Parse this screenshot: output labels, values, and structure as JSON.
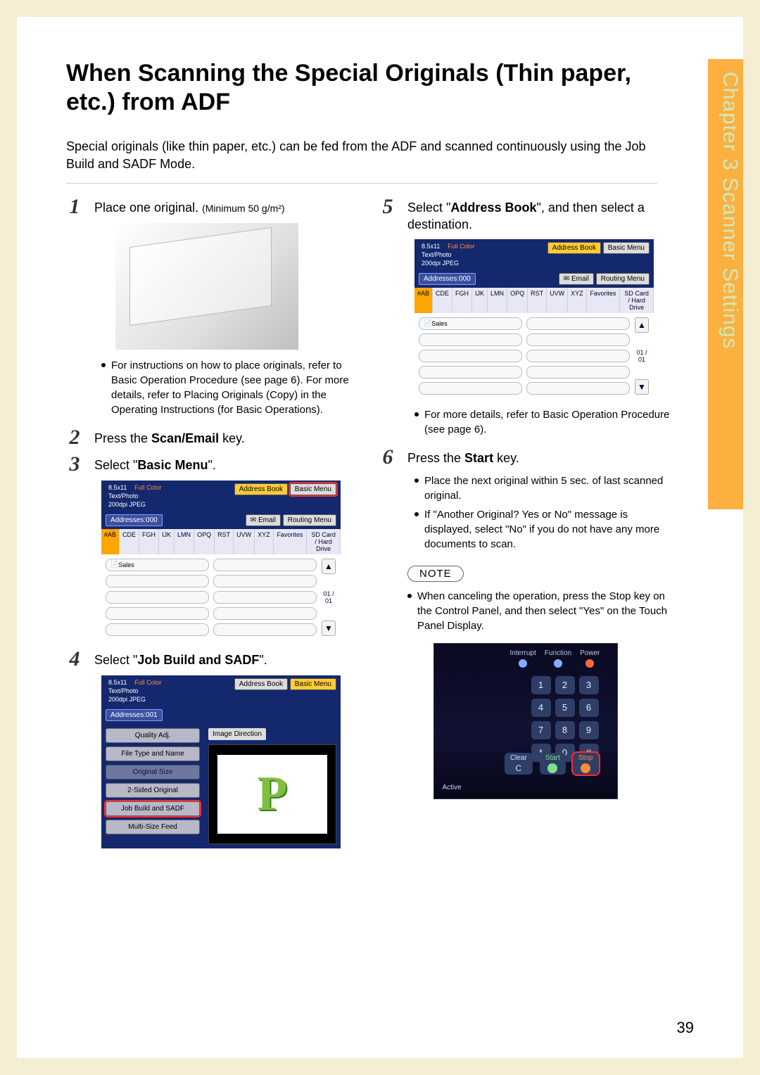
{
  "sideTab": "Chapter 3    Scanner Settings",
  "title": "When Scanning the Special Originals (Thin paper, etc.) from ADF",
  "intro": "Special originals (like thin paper, etc.) can be fed from the ADF and scanned continuously using the Job Build and SADF Mode.",
  "pageNumber": "39",
  "steps": {
    "s1_pre": "Place one original. ",
    "s1_sub": "(Minimum 50 g/m²)",
    "s1_bullet": "For instructions on how to place originals, refer to Basic Operation Procedure (see page 6). For more details, refer to Placing Originals (Copy) in the Operating Instructions (for Basic Operations).",
    "s2_a": "Press the ",
    "s2_b": "Scan/Email",
    "s2_c": " key.",
    "s3_a": "Select \"",
    "s3_b": "Basic Menu",
    "s3_c": "\".",
    "s4_a": "Select \"",
    "s4_b": "Job Build and SADF",
    "s4_c": "\".",
    "s5_a": "Select \"",
    "s5_b": "Address Book",
    "s5_c": "\", and then select a destination.",
    "s5_bullet": "For more details, refer to Basic Operation Procedure (see page 6).",
    "s6_a": "Press the ",
    "s6_b": "Start",
    "s6_c": " key.",
    "s6_b1": "Place the next original within 5 sec. of last scanned original.",
    "s6_b2": "If \"Another Original? Yes or No\" message is displayed, select \"No\" if you do not have any more documents to scan.",
    "noteLabel": "NOTE",
    "noteBullet": "When canceling the operation, press the Stop key on the Control Panel, and then select \"Yes\" on the Touch Panel Display."
  },
  "screen": {
    "size": "8.5x11",
    "color": "Full Color",
    "mode": "Text/Photo",
    "res": "200dpi JPEG",
    "addresses0": "Addresses:000",
    "addresses1": "Addresses:001",
    "addressBook": "Address Book",
    "basicMenu": "Basic Menu",
    "email": "Email",
    "routing": "Routing Menu",
    "favorites": "Favorites",
    "sdcard": "SD Card / Hard Drive",
    "sales": "Sales",
    "count": "01 / 01",
    "tabs": [
      "#AB",
      "CDE",
      "FGH",
      "IJK",
      "LMN",
      "OPQ",
      "RST",
      "UVW",
      "XYZ"
    ],
    "menu": {
      "imageDirection": "Image Direction",
      "items": [
        "Quality Adj.",
        "File Type and Name",
        "Original Size",
        "2-Sided Original",
        "Job Build and SADF",
        "Multi-Size Feed"
      ]
    }
  },
  "panel": {
    "topIcons": [
      "Interrupt",
      "Function",
      "Power"
    ],
    "keys": [
      "1",
      "2",
      "3",
      "4",
      "5",
      "6",
      "7",
      "8",
      "9",
      "*",
      "0",
      "#"
    ],
    "clear": "Clear",
    "c": "C",
    "start": "Start",
    "stop": "Stop",
    "active": "Active"
  }
}
